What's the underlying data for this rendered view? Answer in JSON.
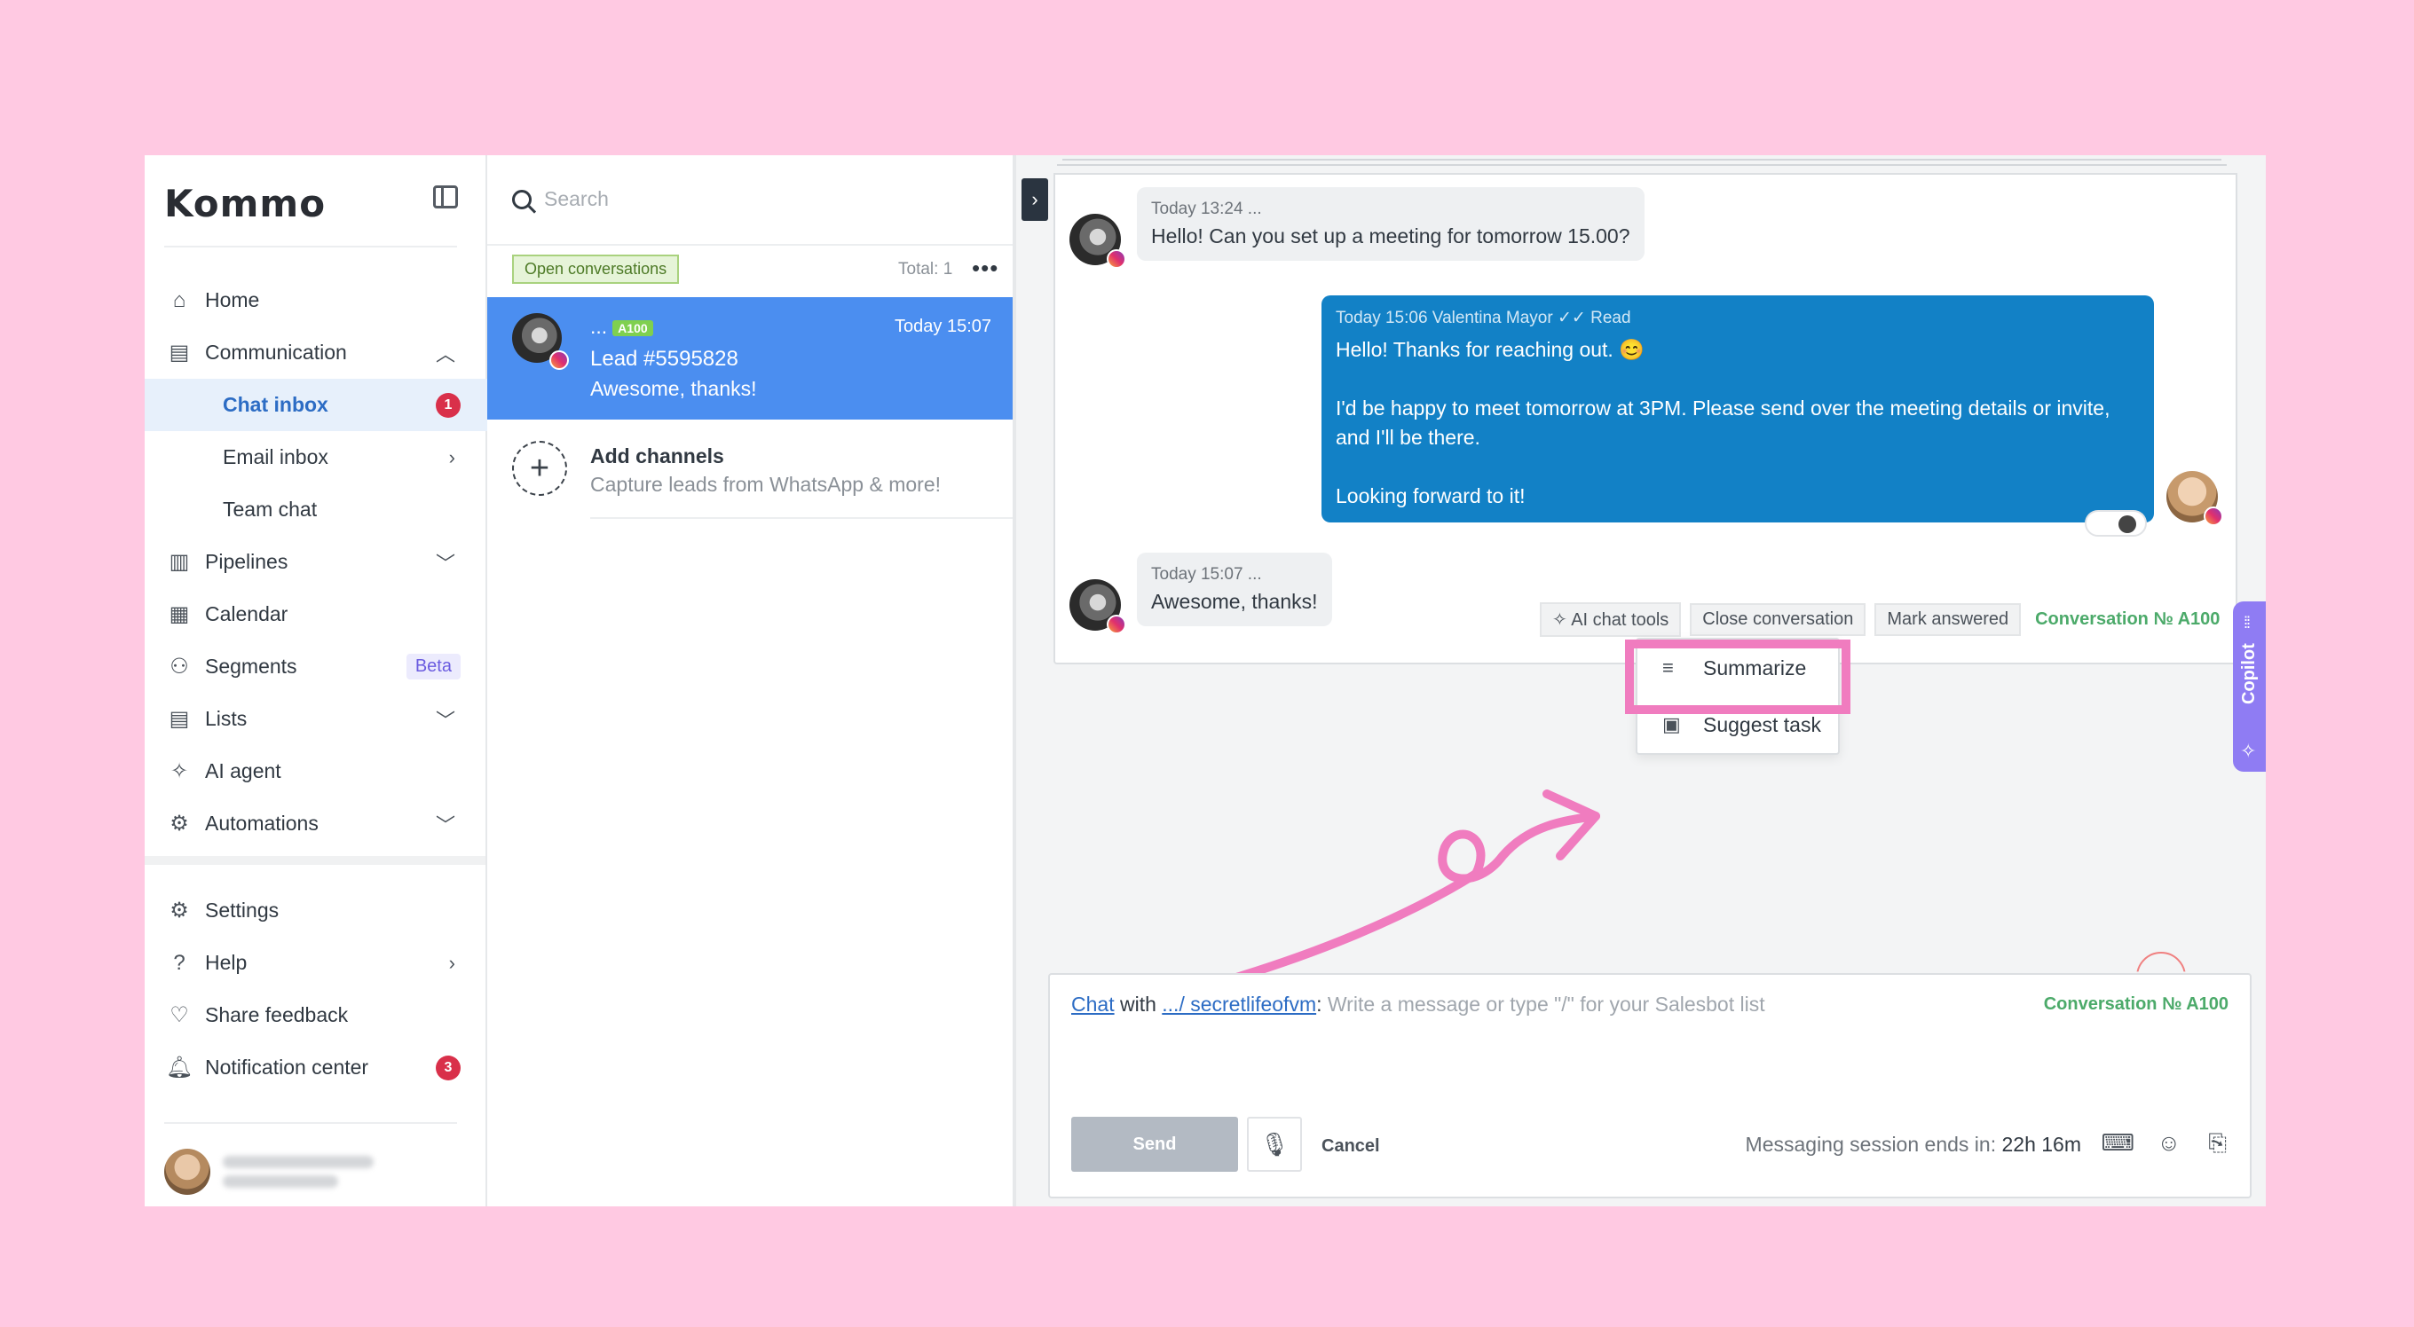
{
  "brand": {
    "logo": "Kommo"
  },
  "sidebar": {
    "items": [
      {
        "label": "Home",
        "icon": "home-icon"
      },
      {
        "label": "Communication",
        "icon": "chat-icon",
        "chevron": "up"
      },
      {
        "label": "Chat inbox",
        "badge": "1",
        "active": true
      },
      {
        "label": "Email inbox",
        "chevron": "right"
      },
      {
        "label": "Team chat"
      },
      {
        "label": "Pipelines",
        "icon": "pipeline-icon",
        "chevron": "down"
      },
      {
        "label": "Calendar",
        "icon": "calendar-icon"
      },
      {
        "label": "Segments",
        "icon": "segments-icon",
        "badge": "Beta"
      },
      {
        "label": "Lists",
        "icon": "list-icon",
        "chevron": "down"
      },
      {
        "label": "AI agent",
        "icon": "sparkle-icon"
      },
      {
        "label": "Automations",
        "icon": "automation-icon",
        "chevron": "down"
      }
    ],
    "bottom_items": [
      {
        "label": "Settings",
        "icon": "gear-icon"
      },
      {
        "label": "Help",
        "icon": "help-icon",
        "chevron": "right"
      },
      {
        "label": "Share feedback",
        "icon": "heart-icon"
      },
      {
        "label": "Notification center",
        "icon": "bell-icon",
        "badge": "3"
      }
    ]
  },
  "conversations": {
    "search_placeholder": "Search",
    "filter": "Open conversations",
    "total": "Total: 1",
    "selected": {
      "name": "...",
      "tag": "A100",
      "time": "Today 15:07",
      "lead": "Lead #5595828",
      "last_message": "Awesome, thanks!"
    },
    "add_channels": {
      "title": "Add channels",
      "subtitle": "Capture leads from WhatsApp & more!"
    }
  },
  "thread": {
    "msg1": {
      "meta": "Today 13:24 ...",
      "text": "Hello! Can you set up a meeting for tomorrow 15.00?"
    },
    "reply": {
      "meta": "Today 15:06 Valentina Mayor",
      "read": "Read",
      "line1": "Hello! Thanks for reaching out. 😊",
      "line2": "I'd be happy to meet tomorrow at 3PM. Please send over the meeting details or invite, and I'll be there.",
      "line3": "Looking forward to it!"
    },
    "msg2": {
      "meta": "Today 15:07 ...",
      "text": "Awesome, thanks!"
    },
    "actions": {
      "ai_tools": "AI chat tools",
      "close": "Close conversation",
      "mark": "Mark answered",
      "conv_no": "Conversation № A100"
    }
  },
  "dropdown": {
    "summarize": "Summarize",
    "suggest": "Suggest task"
  },
  "copilot": {
    "label": "Copilot"
  },
  "composer": {
    "chat_link": "Chat",
    "with": " with ",
    "contact": ".../ secretlifeofvm",
    "colon": ":",
    "placeholder": " Write a message or type \"/\" for your Salesbot list",
    "conv_no": "Conversation № A100",
    "send": "Send",
    "cancel": "Cancel",
    "session_label": "Messaging session ends in:",
    "session_value": "22h 16m"
  },
  "colors": {
    "accent": "#1281c6",
    "highlight": "#f07cbf",
    "background": "#ffc9e2",
    "copilot": "#8f7cf3"
  }
}
